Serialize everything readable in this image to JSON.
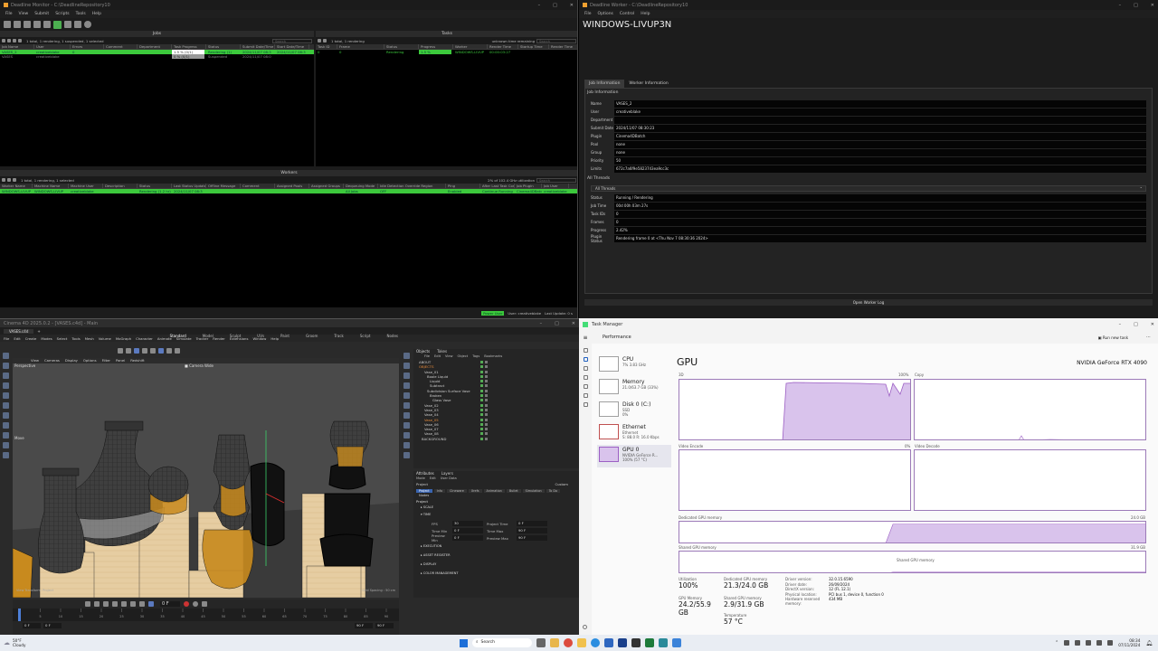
{
  "monitor": {
    "title": "Deadline Monitor  -  C:\\DeadlineRepository10",
    "menu": [
      "File",
      "View",
      "Submit",
      "Scripts",
      "Tools",
      "Help"
    ],
    "jobs": {
      "panel_title": "Jobs",
      "summary": "1 total, 1 rendering, 1 suspended, 1 selected",
      "search": "Search",
      "columns": [
        "Job Name",
        "User",
        "Errors",
        "Comment",
        "Department",
        "Task Progress",
        "Status",
        "Submit Date/Time",
        "Start Date/Time"
      ],
      "rows": [
        {
          "name": "VASES_2",
          "user": "creativeblake",
          "errors": "0",
          "progress": "1.5 %  (0/1)",
          "status": "Rendering (1)",
          "submit": "2024/11/07 08:3",
          "start": "2024/11/07 08:3"
        },
        {
          "name": "VASES",
          "user": "creativeblake",
          "errors": "",
          "progress": "0 %  (0/1)",
          "status": "Suspended",
          "submit": "2024/11/07 08:0",
          "start": ""
        }
      ]
    },
    "tasks": {
      "panel_title": "Tasks",
      "summary": "1 total, 1 rendering",
      "time_remaining": "unknown time remaining",
      "search": "Search",
      "columns": [
        "Task ID",
        "Frame",
        "Status",
        "Progress",
        "Worker",
        "Render Time",
        "Startup Time",
        "Render Time"
      ],
      "rows": [
        {
          "id": "0",
          "frame": "0",
          "status": "Rendering",
          "progress": "1.5 %",
          "worker": "WINDOWS-LIVUP",
          "render_time": "00:00:03:27"
        }
      ]
    },
    "workers": {
      "panel_title": "Workers",
      "summary": "1 total, 1 rendering, 1 selected",
      "utilization": "2% of 102.4 GHz utilization",
      "search": "Search",
      "columns": [
        "Worker Name",
        "Machine Name",
        "Machine User",
        "Description",
        "Status",
        "Last Status Update",
        "Offline Message",
        "Comment",
        "Assigned Pools",
        "Assigned Groups",
        "Dequeuing Mode",
        "Idle Detection Override Region",
        "Ping",
        "After Last Task Complete",
        "Job Plugin",
        "Job User"
      ],
      "rows": [
        {
          "name": "WINDOWS-LIVUP",
          "machine": "WINDOWS-LIVUP",
          "user": "creativeblake",
          "status": "Rendering (1.2 hr)",
          "last": "2024/11/07 08:3",
          "mode": "All Jobs",
          "region": "OFF",
          "ping": "Enabled",
          "after": "Continue Running",
          "plugin": "Cinema4DBatch",
          "jobuser": "creativeblake"
        }
      ]
    },
    "status": {
      "mode": "Power User",
      "user": "User: creativeblake",
      "update": "Last Update: 0 s"
    }
  },
  "worker": {
    "title": "Deadline Worker  -  C:\\DeadlineRepository10",
    "menu": [
      "File",
      "Options",
      "Control",
      "Help"
    ],
    "machine": "WINDOWS-LIVUP3N",
    "tabs": [
      "Job Information",
      "Worker Information"
    ],
    "section1": "Job Information",
    "job_fields": [
      {
        "label": "Name",
        "value": "VASES_2"
      },
      {
        "label": "User",
        "value": "creativeblake"
      },
      {
        "label": "Department",
        "value": ""
      },
      {
        "label": "Submit Date",
        "value": "2024/11/07 08:30:23"
      },
      {
        "label": "Plugin",
        "value": "Cinema4DBatch"
      },
      {
        "label": "Pool",
        "value": "none"
      },
      {
        "label": "Group",
        "value": "none"
      },
      {
        "label": "Priority",
        "value": "50"
      },
      {
        "label": "Limits",
        "value": "672c7a6f9e5823743ea9cc3c"
      }
    ],
    "section2": "All Threads",
    "threads_dropdown": "All Threads",
    "thread_fields": [
      {
        "label": "Status",
        "value": "Running / Rendering"
      },
      {
        "label": "Job Time",
        "value": "00d 00h 03m 27s"
      },
      {
        "label": "Task IDs",
        "value": "0"
      },
      {
        "label": "Frames",
        "value": "0"
      },
      {
        "label": "Progress",
        "value": "2.42%"
      },
      {
        "label": "Plugin Status",
        "value": "Rendering frame 0 at <Thu Nov  7 08:30:36 2024>"
      }
    ],
    "button": "Open Worker Log"
  },
  "c4d": {
    "title": "Cinema 4D 2025.0.2 - [VASES.c4d] - Main",
    "file_tab": "VASES.c4d",
    "menu": [
      "File",
      "Edit",
      "Create",
      "Modes",
      "Select",
      "Tools",
      "Mesh",
      "Volume",
      "MoGraph",
      "Character",
      "Animate",
      "Simulate",
      "Tracker",
      "Render",
      "Extensions",
      "Window",
      "Help"
    ],
    "layouts": [
      "Standard",
      "Model",
      "Sculpt",
      "UVs",
      "Paint",
      "Groom",
      "Track",
      "Script",
      "Nodes"
    ],
    "viewport_menu": [
      "View",
      "Cameras",
      "Display",
      "Options",
      "Filter",
      "Panel",
      "Redshift"
    ],
    "viewport_label": "Perspective",
    "camera_label": "Camera Wide",
    "move_label": "Move",
    "transform_label": "View Transform: Project",
    "grid_label": "Grid Spacing : 50 cm",
    "objects_tabs": [
      "Objects",
      "Takes"
    ],
    "objects_menu": [
      "File",
      "Edit",
      "View",
      "Object",
      "Tags",
      "Bookmarks"
    ],
    "objects": [
      "ABOUT",
      "OBJECTS",
      "Vase_01",
      "Boole Liquid",
      "Liquid",
      "Subtract",
      "Subdivision Surface Vase",
      "Broken",
      "Glass Vase",
      "Vase_02",
      "Vase_03",
      "Vase_04",
      "Vase_05",
      "Vase_06",
      "Vase_07",
      "Vase_08",
      "BACKGROUND"
    ],
    "attr_tabs": [
      "Attributes",
      "Layers"
    ],
    "attr_menu": [
      "Mode",
      "Edit",
      "User Data"
    ],
    "attr_mode": "Project",
    "attr_custom": "Custom",
    "attr_subtabs": [
      "Project",
      "Info",
      "Cineware",
      "Xrefs",
      "Animation",
      "Bullet",
      "Simulation",
      "To Do"
    ],
    "attr_nodes": "Nodes",
    "attr_section": "Project",
    "attr_groups": [
      "SCALE",
      "TIME",
      "EXECUTION",
      "ASSET REGISTER",
      "DISPLAY",
      "COLOR MANAGEMENT"
    ],
    "time_fields": [
      {
        "l1": "FPS",
        "v1": "30",
        "l2": "Project Time",
        "v2": "0 F"
      },
      {
        "l1": "Time Min",
        "v1": "0 F",
        "l2": "Time Max",
        "v2": "90 F"
      },
      {
        "l1": "Preview Min",
        "v1": "0 F",
        "l2": "Preview Max",
        "v2": "90 F"
      }
    ],
    "frame_field": "0 F",
    "timeline_start": "0 F",
    "timeline_end": "90 F",
    "timeline_end2": "90 F",
    "timeline_ticks": [
      "0",
      "5",
      "10",
      "15",
      "20",
      "25",
      "30",
      "35",
      "40",
      "45",
      "50",
      "55",
      "60",
      "65",
      "70",
      "75",
      "80",
      "85",
      "90"
    ]
  },
  "taskmgr": {
    "title": "Task Manager",
    "section": "Performance",
    "run_task": "Run new task",
    "items": [
      {
        "name": "CPU",
        "sub": "7%  3.83 GHz",
        "sub2": ""
      },
      {
        "name": "Memory",
        "sub": "21.0/63.7 GB (33%)",
        "sub2": ""
      },
      {
        "name": "Disk 0 (C:)",
        "sub": "SSD",
        "sub2": "0%"
      },
      {
        "name": "Ethernet",
        "sub": "Ethernet",
        "sub2": "S: 88.0  R: 16.0 Kbps"
      },
      {
        "name": "GPU 0",
        "sub": "NVIDIA GeForce R...",
        "sub2": "100% (57 °C)"
      }
    ],
    "gpu_title": "GPU",
    "gpu_name": "NVIDIA GeForce RTX 4090",
    "graph_labels": {
      "g1": "3D",
      "g1p": "100%",
      "g2": "Copy",
      "g3": "Video Encode",
      "g3p": "0%",
      "g4": "Video Decode",
      "ded": "Dedicated GPU memory",
      "ded_max": "24.0 GB",
      "shared": "Shared GPU memory",
      "shared_max": "31.9 GB",
      "shared_label": "Shared GPU memory"
    },
    "stats": [
      {
        "label": "Utilization",
        "value": "100%"
      },
      {
        "label": "Dedicated GPU memory",
        "value": "21.3/24.0 GB"
      },
      {
        "label": "GPU Memory",
        "value": "24.2/55.9 GB"
      },
      {
        "label": "Shared GPU memory",
        "value": "2.9/31.9 GB"
      },
      {
        "label": "Temperature",
        "value": "57 °C"
      }
    ],
    "details": [
      {
        "k": "Driver version:",
        "v": "32.0.15.6590"
      },
      {
        "k": "Driver date:",
        "v": "26/09/2024"
      },
      {
        "k": "DirectX version:",
        "v": "12 (FL 12.1)"
      },
      {
        "k": "Physical location:",
        "v": "PCI bus 1, device 0, function 0"
      },
      {
        "k": "Hardware reserved memory:",
        "v": "434 MB"
      }
    ],
    "gpu_3d_util": 1.0,
    "dedicated_fraction": 0.89,
    "shared_fraction": 0.09
  },
  "taskbar": {
    "weather_temp": "50°F",
    "weather_desc": "Cloudy",
    "search": "Search",
    "time": "08:34",
    "date": "07/11/2024"
  }
}
